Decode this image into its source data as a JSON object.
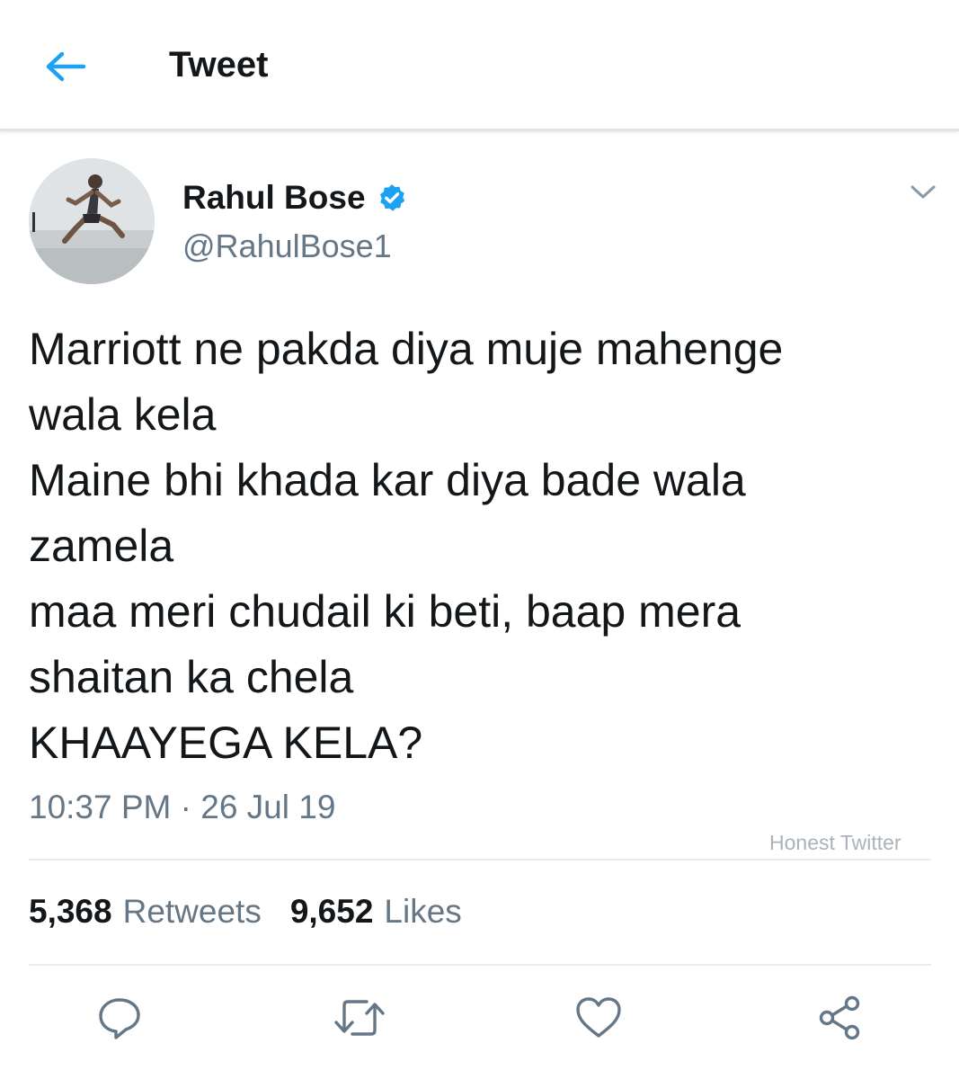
{
  "header": {
    "title": "Tweet",
    "back_icon": "arrow-left-icon"
  },
  "author": {
    "display_name": "Rahul Bose",
    "handle": "@RahulBose1",
    "verified_icon": "verified-badge-icon"
  },
  "tweet": {
    "lines": [
      "Marriott ne pakda diya muje mahenge",
      "wala kela",
      "Maine bhi khada kar diya bade wala",
      "zamela",
      "maa meri chudail ki beti, baap mera",
      "shaitan ka chela",
      "KHAAYEGA KELA?"
    ],
    "timestamp": "10:37 PM · 26 Jul 19"
  },
  "watermark": "Honest Twitter",
  "stats": {
    "retweets_count": "5,368",
    "retweets_label": "Retweets",
    "likes_count": "9,652",
    "likes_label": "Likes"
  },
  "actions": [
    "reply-icon",
    "retweet-icon",
    "like-icon",
    "share-icon"
  ],
  "colors": {
    "accent": "#1da1f2",
    "text": "#14171a",
    "secondary_text": "#657786",
    "icon_gray": "#657786"
  }
}
